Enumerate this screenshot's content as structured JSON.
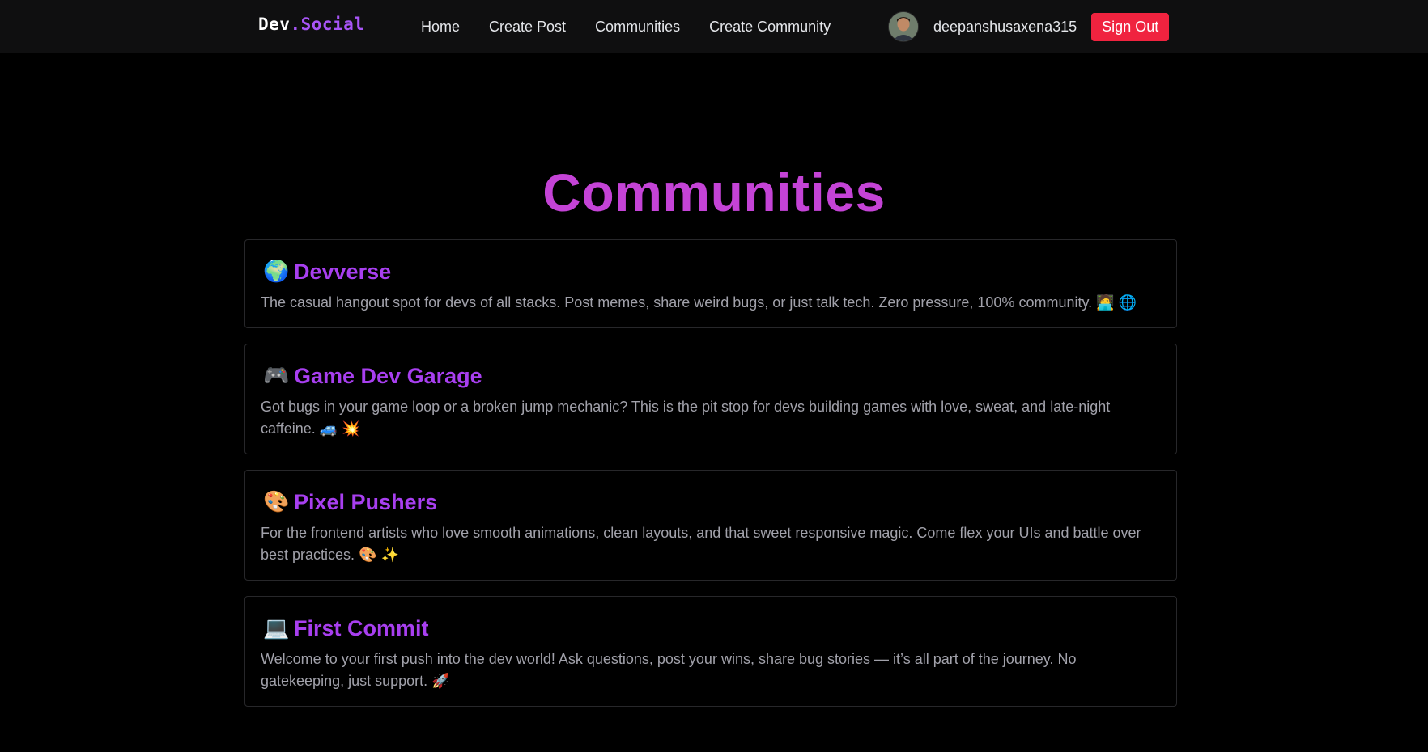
{
  "nav": {
    "logo_main": "Dev",
    "logo_accent": ".Social",
    "links": [
      "Home",
      "Create Post",
      "Communities",
      "Create Community"
    ],
    "username": "deepanshusaxena315",
    "signout_label": "Sign Out",
    "avatar_icon": "user-avatar-photo"
  },
  "page": {
    "title": "Communities"
  },
  "communities": [
    {
      "icon": "🌍",
      "icon_name": "globe-icon",
      "name": "Devverse",
      "description": "The casual hangout spot for devs of all stacks. Post memes, share weird bugs, or just talk tech. Zero pressure, 100% community. 🧑‍💻 🌐"
    },
    {
      "icon": "🎮",
      "icon_name": "game-controller-icon",
      "name": "Game Dev Garage",
      "description": "Got bugs in your game loop or a broken jump mechanic? This is the pit stop for devs building games with love, sweat, and late-night caffeine. 🚙 💥"
    },
    {
      "icon": "🎨",
      "icon_name": "palette-icon",
      "name": "Pixel Pushers",
      "description": "For the frontend artists who love smooth animations, clean layouts, and that sweet responsive magic. Come flex your UIs and battle over best practices. 🎨 ✨"
    },
    {
      "icon": "💻",
      "icon_name": "laptop-icon",
      "name": "First Commit",
      "description": "Welcome to your first push into the dev world! Ask questions, post your wins, share bug stories — it’s all part of the journey. No gatekeeping, just support. 🚀"
    }
  ],
  "colors": {
    "background": "#000000",
    "navbar": "#0f0f10",
    "title": "#c443d6",
    "card_title": "#a83ff0",
    "logo_accent": "#a855f7",
    "signout": "#f0233f",
    "card_border": "#27272a",
    "description": "#a1a1aa"
  }
}
